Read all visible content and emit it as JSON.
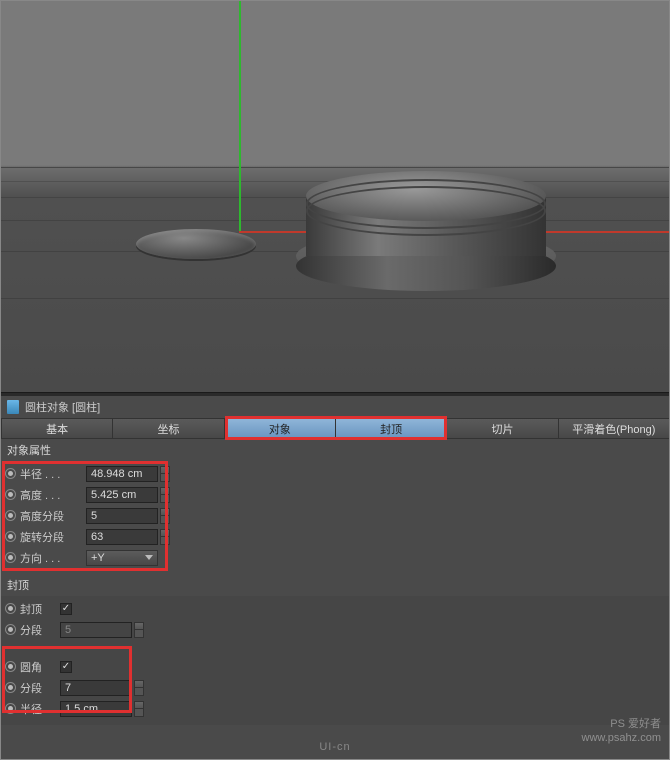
{
  "title": {
    "icon": "cylinder-icon",
    "text": "圆柱对象 [圆柱]"
  },
  "tabs": {
    "basic": "基本",
    "coord": "坐标",
    "object": "对象",
    "cap": "封顶",
    "slice": "切片",
    "phong": "平滑着色(Phong)"
  },
  "sections": {
    "objprops": "对象属性",
    "cap": "封顶"
  },
  "obj": {
    "radius": {
      "label": "半径 . . .",
      "value": "48.948 cm"
    },
    "height": {
      "label": "高度 . . .",
      "value": "5.425 cm"
    },
    "hseg": {
      "label": "高度分段",
      "value": "5"
    },
    "rseg": {
      "label": "旋转分段",
      "value": "63"
    },
    "dir": {
      "label": "方向 . . .",
      "value": "+Y"
    }
  },
  "cap": {
    "cap": {
      "label": "封顶",
      "checked": true
    },
    "seg": {
      "label": "分段",
      "value": "5"
    },
    "fillet": {
      "label": "圆角",
      "checked": true
    },
    "fseg": {
      "label": "分段",
      "value": "7"
    },
    "frad": {
      "label": "半径",
      "value": "1.5 cm"
    }
  },
  "watermark": {
    "logo": "UI-cn",
    "site_cn": "PS 爱好者",
    "site_url": "www.psahz.com"
  }
}
